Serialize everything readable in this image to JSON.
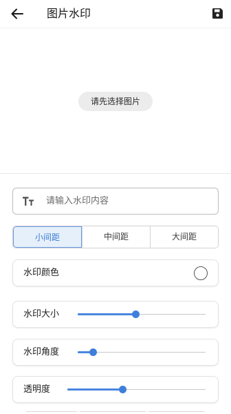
{
  "header": {
    "title": "图片水印",
    "back_icon": "arrow-left-icon",
    "save_icon": "floppy-disk-icon"
  },
  "preview": {
    "select_image_label": "请先选择图片"
  },
  "watermark_text": {
    "icon": "text-size-icon",
    "placeholder": "请输入水印内容",
    "value": ""
  },
  "spacing": {
    "options": [
      "小间距",
      "中间距",
      "大间距"
    ],
    "selected": "小间距"
  },
  "color": {
    "label": "水印颜色",
    "value": "#ffffff"
  },
  "size": {
    "label": "水印大小",
    "value_fraction": 0.45
  },
  "angle": {
    "label": "水印角度",
    "value_fraction": 0.12
  },
  "opacity": {
    "label": "透明度",
    "value_fraction": 0.4
  },
  "colors": {
    "accent": "#3f7fdc",
    "selected_bg": "#e6f0fb"
  }
}
